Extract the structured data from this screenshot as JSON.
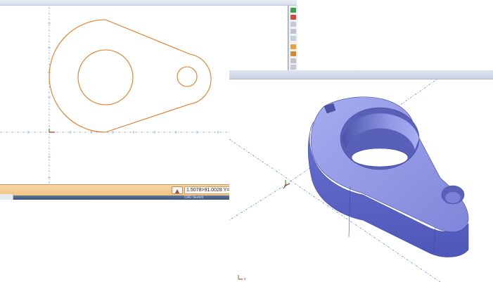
{
  "sketch": {
    "status": {
      "coordinates": "1.5078>91.0028 Y=2.6",
      "taskbar_text": "CAD Sketch"
    },
    "toolbar_icons": [
      "check-icon",
      "sketch-icon",
      "line-icon",
      "list-icon",
      "grid-icon",
      "folder-icon",
      "gear-icon",
      "measure-icon",
      "arrow-icon"
    ]
  },
  "viewport3d": {
    "axis_label": "x"
  },
  "colors": {
    "sketch_profile": "#e07a25",
    "part_top": "#8f96e4",
    "part_side": "#5a64c8",
    "part_shadow": "#3f47a0",
    "axis_dash": "#6f95c4"
  }
}
